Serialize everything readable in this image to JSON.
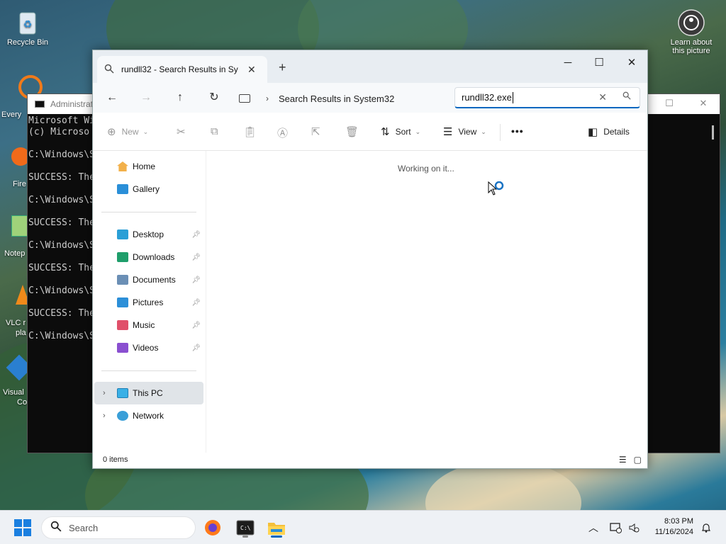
{
  "desktop": {
    "recycle_bin": "Recycle Bin",
    "learn_about": "Learn about this picture",
    "side_labels": [
      "Every",
      "Fire",
      "Notep",
      "VLC r",
      "pla",
      "Visual",
      "Co"
    ]
  },
  "console": {
    "title": "Administrat",
    "lines": [
      "Microsoft Wi",
      "(c) Microso",
      "",
      "C:\\Windows\\S",
      "",
      "SUCCESS: The",
      "",
      "C:\\Windows\\S",
      "",
      "SUCCESS: The",
      "",
      "C:\\Windows\\S",
      "",
      "SUCCESS: The",
      "",
      "C:\\Windows\\S",
      "",
      "SUCCESS: The",
      "",
      "C:\\Windows\\S"
    ]
  },
  "explorer": {
    "tab_title": "rundll32 - Search Results in Sy",
    "window_controls": {
      "minimize": "─",
      "maximize": "☐",
      "close": "✕"
    },
    "breadcrumb": "Search Results in System32",
    "search_value": "rundll32.exe",
    "commands": {
      "new": "New",
      "sort": "Sort",
      "view": "View",
      "more": "•••",
      "details": "Details"
    },
    "sidebar": {
      "home": "Home",
      "gallery": "Gallery",
      "quick_access": [
        {
          "label": "Desktop",
          "color": "#2a9fd6"
        },
        {
          "label": "Downloads",
          "color": "#1f9e6b"
        },
        {
          "label": "Documents",
          "color": "#6b8fb5"
        },
        {
          "label": "Pictures",
          "color": "#2c8fd8"
        },
        {
          "label": "Music",
          "color": "#e0506a"
        },
        {
          "label": "Videos",
          "color": "#8a4fd0"
        }
      ],
      "this_pc": "This PC",
      "network": "Network"
    },
    "working_text": "Working on it...",
    "status": "0 items"
  },
  "taskbar": {
    "search_placeholder": "Search",
    "time": "8:03 PM",
    "date": "11/16/2024"
  },
  "colors": {
    "accent": "#0067c0",
    "start": "#1a7fe0"
  }
}
